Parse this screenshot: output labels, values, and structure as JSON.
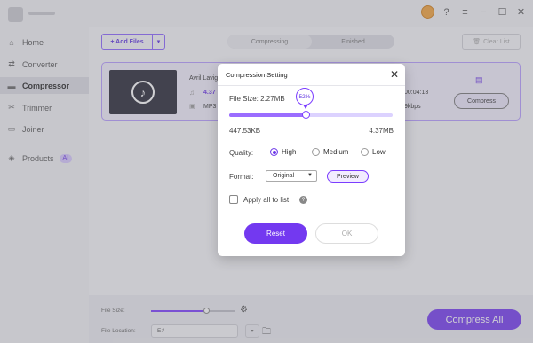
{
  "window": {
    "controls": {
      "minimize": "−",
      "maximize": "☐",
      "close": "✕",
      "menu": "≡",
      "help": "?"
    }
  },
  "sidebar": {
    "items": [
      {
        "label": "Home",
        "icon": "home-icon"
      },
      {
        "label": "Converter",
        "icon": "convert-icon"
      },
      {
        "label": "Compressor",
        "icon": "compress-icon"
      },
      {
        "label": "Trimmer",
        "icon": "scissors-icon"
      },
      {
        "label": "Joiner",
        "icon": "joiner-icon"
      },
      {
        "label": "Products",
        "icon": "products-icon",
        "badge": "AI"
      }
    ],
    "active": "Compressor"
  },
  "toolbar": {
    "add_files": "+ Add Files",
    "tab_compressing": "Compressing",
    "tab_finished": "Finished",
    "clear_list": "Clear List"
  },
  "file": {
    "name": "Avril Lavig",
    "size": "4.37",
    "format": "MP3",
    "duration": "00:04:13",
    "bitrate": "9kbps",
    "compress_label": "Compress"
  },
  "bottom": {
    "file_size_label": "File Size:",
    "file_size_level": 0.66,
    "file_location_label": "File Location:",
    "file_location_value": "E:/",
    "compress_all": "Compress All"
  },
  "dialog": {
    "title": "Compression Setting",
    "file_size_label": "File Size: 2.27MB",
    "percent": "52%",
    "slider_level": 0.47,
    "min": "447.53KB",
    "max": "4.37MB",
    "quality_label": "Quality:",
    "quality_options": [
      "High",
      "Medium",
      "Low"
    ],
    "quality_selected": "High",
    "format_label": "Format:",
    "format_value": "Original",
    "preview": "Preview",
    "apply_all": "Apply all to list",
    "reset": "Reset",
    "ok": "OK"
  },
  "colors": {
    "accent": "#7339f0",
    "accent_light": "#9b6dff",
    "sidebar_active": "#dcdce3"
  }
}
